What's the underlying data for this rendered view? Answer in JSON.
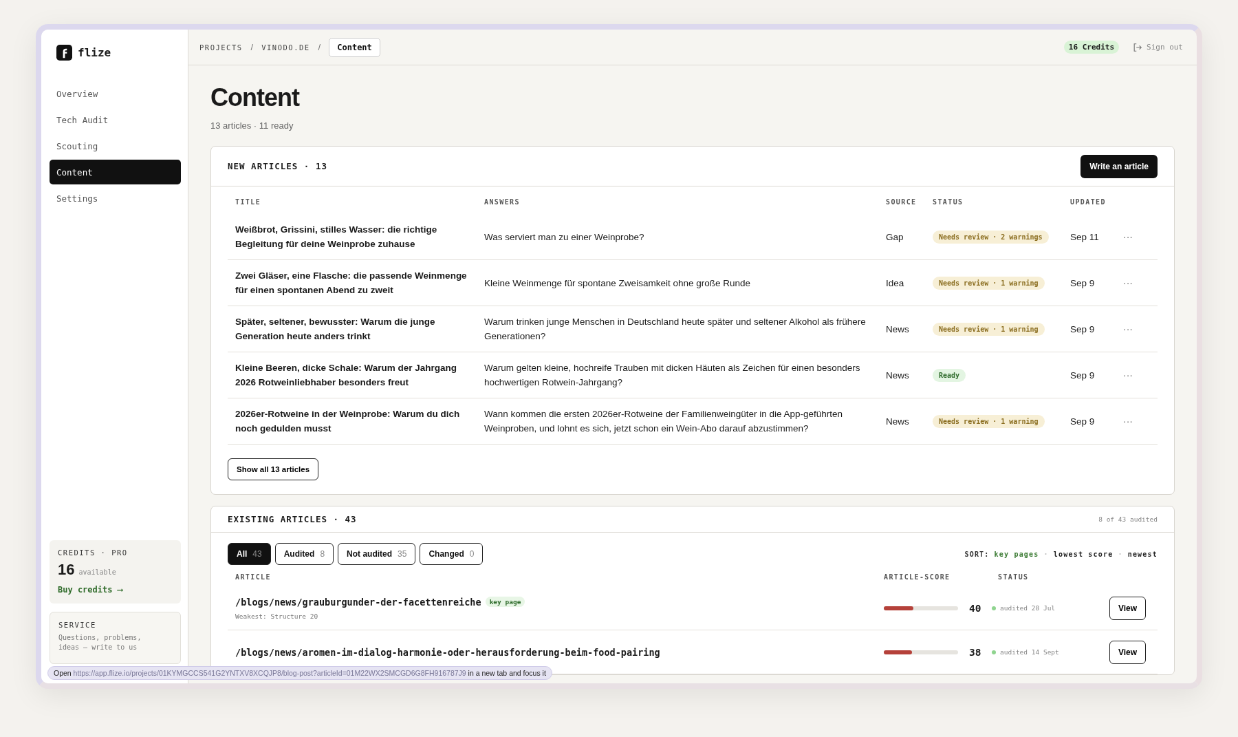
{
  "brand": {
    "name": "flize"
  },
  "sidebar": {
    "items": [
      {
        "label": "Overview",
        "selected": false
      },
      {
        "label": "Tech Audit",
        "selected": false
      },
      {
        "label": "Scouting",
        "selected": false
      },
      {
        "label": "Content",
        "selected": true
      },
      {
        "label": "Settings",
        "selected": false
      }
    ],
    "credits": {
      "title": "CREDITS · PRO",
      "amount": "16",
      "unit": "available",
      "link": "Buy credits ⟶"
    },
    "service": {
      "title": "SERVICE",
      "text": "Questions, problems, ideas — write to us"
    }
  },
  "breadcrumb": {
    "separator": "/",
    "items": [
      {
        "label": "PROJECTS",
        "selected": false
      },
      {
        "label": "VINODO.DE",
        "selected": false
      },
      {
        "label": "Content",
        "selected": true
      }
    ]
  },
  "header": {
    "credits_badge": "16 Credits",
    "sign_out": "Sign out"
  },
  "page": {
    "title": "Content",
    "subtitle": "13 articles · 11 ready"
  },
  "new_articles": {
    "title": "NEW ARTICLES · 13",
    "button": "Write an article",
    "columns": [
      "TITLE",
      "ANSWERS",
      "SOURCE",
      "STATUS",
      "UPDATED"
    ],
    "rows": [
      {
        "title": "Weißbrot, Grissini, stilles Wasser: die richtige Begleitung für deine Weinprobe zuhause",
        "answers": "Was serviert man zu einer Weinprobe?",
        "source": "Gap",
        "status": {
          "label": "Needs review · 2 warnings",
          "kind": "warning"
        },
        "updated": "Sep 11",
        "menu": "···"
      },
      {
        "title": "Zwei Gläser, eine Flasche: die passende Weinmenge für einen spontanen Abend zu zweit",
        "answers": "Kleine Weinmenge für spontane Zweisamkeit ohne große Runde",
        "source": "Idea",
        "status": {
          "label": "Needs review · 1 warning",
          "kind": "warning"
        },
        "updated": "Sep 9",
        "menu": "···"
      },
      {
        "title": "Später, seltener, bewusster: Warum die junge Generation heute anders trinkt",
        "answers": "Warum trinken junge Menschen in Deutschland heute später und seltener Alkohol als frühere Generationen?",
        "source": "News",
        "status": {
          "label": "Needs review · 1 warning",
          "kind": "warning"
        },
        "updated": "Sep 9",
        "menu": "···"
      },
      {
        "title": "Kleine Beeren, dicke Schale: Warum der Jahrgang 2026 Rotweinliebhaber besonders freut",
        "answers": "Warum gelten kleine, hochreife Trauben mit dicken Häuten als Zeichen für einen besonders hochwertigen Rotwein-Jahrgang?",
        "source": "News",
        "status": {
          "label": "Ready",
          "kind": "ready"
        },
        "updated": "Sep 9",
        "menu": "···"
      },
      {
        "title": "2026er-Rotweine in der Weinprobe: Warum du dich noch gedulden musst",
        "answers": "Wann kommen die ersten 2026er-Rotweine der Familienweingüter in die App-geführten Weinproben, und lohnt es sich, jetzt schon ein Wein-Abo darauf abzustimmen?",
        "source": "News",
        "status": {
          "label": "Needs review · 1 warning",
          "kind": "warning"
        },
        "updated": "Sep 9",
        "menu": "···"
      }
    ],
    "show_all": "Show all 13 articles"
  },
  "existing_articles": {
    "title": "EXISTING ARTICLES · 43",
    "meta": "8 of 43 audited",
    "filters": [
      {
        "label": "All",
        "count": "43",
        "selected": true
      },
      {
        "label": "Audited",
        "count": "8",
        "selected": false
      },
      {
        "label": "Not audited",
        "count": "35",
        "selected": false
      },
      {
        "label": "Changed",
        "count": "0",
        "selected": false
      }
    ],
    "sort": {
      "label": "SORT:",
      "separator": "·",
      "options": [
        {
          "label": "key pages",
          "selected": true
        },
        {
          "label": "lowest score",
          "selected": false
        },
        {
          "label": "newest",
          "selected": false
        }
      ]
    },
    "columns": [
      "ARTICLE",
      "ARTICLE-SCORE",
      "STATUS"
    ],
    "rows": [
      {
        "path": "/blogs/news/grauburgunder-der-facettenreiche",
        "tag": "key page",
        "weakest": "Weakest: Structure 20",
        "level": 0.4,
        "score": "40",
        "status": "audited 28 Jul",
        "button": "View"
      },
      {
        "path": "/blogs/news/aromen-im-dialog-harmonie-oder-herausforderung-beim-food-pairing",
        "level": 0.38,
        "score": "38",
        "status": "audited 14 Sept",
        "button": "View"
      }
    ]
  },
  "status_tooltip": {
    "prefix": "Open",
    "url": "https://app.flize.io/projects/01KYMGCCS541G2YNTXV8XCQJP8/blog-post?articleId=01M22WX2SMCGD6G8FH916787J9",
    "suffix": "in a new tab and focus it"
  }
}
